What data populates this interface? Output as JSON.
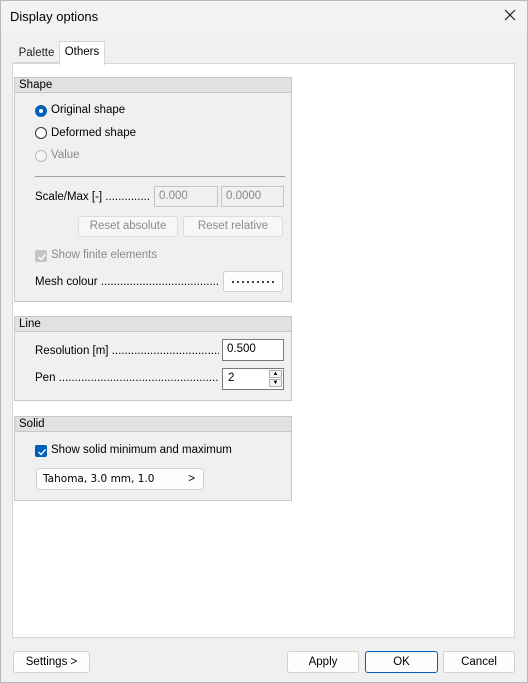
{
  "window": {
    "title": "Display options"
  },
  "tabs": [
    {
      "label": "Palette"
    },
    {
      "label": "Others"
    }
  ],
  "shape": {
    "title": "Shape",
    "original_label": "Original shape",
    "deformed_label": "Deformed shape",
    "value_label": "Value",
    "scale_label": "Scale/Max [-]",
    "scale_value1": "0.000",
    "scale_value2": "0.0000",
    "reset_absolute": "Reset absolute",
    "reset_relative": "Reset relative",
    "show_finite_label": "Show finite elements",
    "mesh_colour_label": "Mesh colour"
  },
  "line": {
    "title": "Line",
    "resolution_label": "Resolution [m]",
    "resolution_value": "0.500",
    "pen_label": "Pen",
    "pen_value": "2"
  },
  "solid": {
    "title": "Solid",
    "show_minmax_label": "Show solid minimum and maximum",
    "font_button": "Tahoma, 3.0 mm, 1.0",
    "font_arrow": ">"
  },
  "footer": {
    "settings": "Settings >",
    "apply": "Apply",
    "ok": "OK",
    "cancel": "Cancel"
  },
  "colors": {
    "accent": "#005fb8"
  }
}
